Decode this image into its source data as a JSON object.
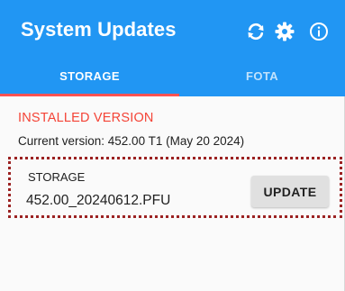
{
  "appbar": {
    "title": "System Updates",
    "background_color": "#2196f3",
    "actions": [
      {
        "icon": "sync-icon"
      },
      {
        "icon": "gear-icon"
      },
      {
        "icon": "info-icon"
      }
    ]
  },
  "tabs": [
    {
      "label": "STORAGE",
      "selected": true
    },
    {
      "label": "FOTA",
      "selected": false
    }
  ],
  "tab_indicator_color": "#ff5252",
  "installed": {
    "heading": "INSTALLED VERSION",
    "heading_color": "#f44336",
    "current_version": "Current version: 452.00 T1 (May 20 2024)"
  },
  "update_item": {
    "label": "STORAGE",
    "file_name": "452.00_20240612.PFU",
    "button_label": "UPDATE"
  },
  "highlight_color": "#9b2222"
}
